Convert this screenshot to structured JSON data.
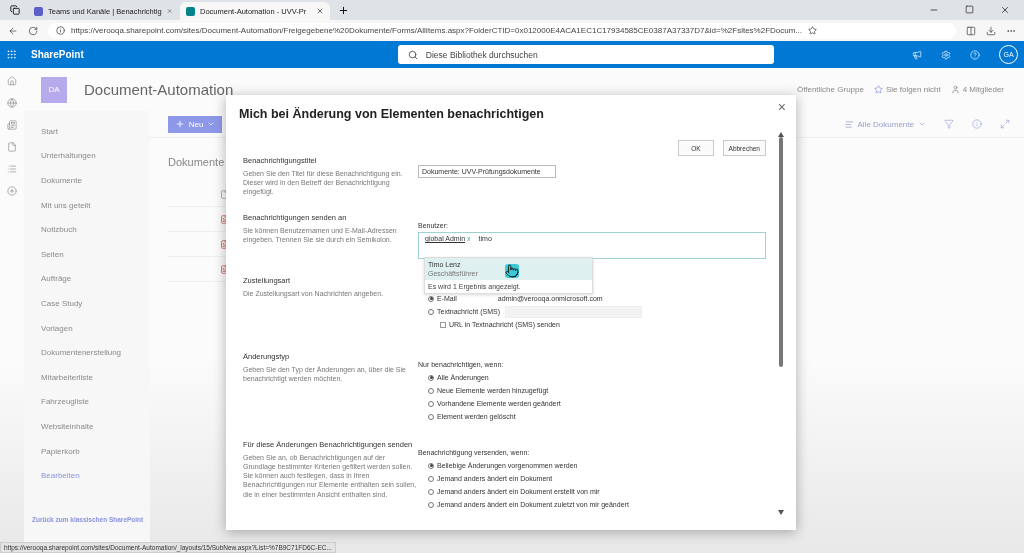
{
  "browser": {
    "tabs": [
      {
        "title": "Teams und Kanäle | Benachrichtig",
        "selected": false
      },
      {
        "title": "Document-Automation - UVV-Pr",
        "selected": true
      }
    ],
    "address": "https://verooqa.sharepoint.com/sites/Document-Automation/Freigegebene%20Dokumente/Forms/AllItems.aspx?FolderCTID=0x012000E4ACA1EC1C17934585CE0387A37337D7&id=%2Fsites%2FDocum..."
  },
  "suite": {
    "brand": "SharePoint",
    "search_placeholder": "Diese Bibliothek durchsuchen",
    "avatar": "GA"
  },
  "site": {
    "logo": "DA",
    "name": "Document-Automation",
    "privacy": "Öffentliche Gruppe",
    "follow": "Sie folgen nicht",
    "members": "4 Mitglieder"
  },
  "nav": {
    "items": [
      {
        "label": "Start",
        "kind": "item"
      },
      {
        "label": "Unterhaltungen",
        "kind": "item"
      },
      {
        "label": "Dokumente",
        "kind": "item"
      },
      {
        "label": "Mit uns geteilt",
        "kind": "item"
      },
      {
        "label": "Notizbuch",
        "kind": "item"
      },
      {
        "label": "Seiten",
        "kind": "item"
      },
      {
        "label": "Aufträge",
        "kind": "item"
      },
      {
        "label": "Case Study",
        "kind": "item"
      },
      {
        "label": "Vorlagen",
        "kind": "item"
      },
      {
        "label": "Dokumentenerstellung",
        "kind": "item"
      },
      {
        "label": "Mitarbeiterliste",
        "kind": "item"
      },
      {
        "label": "Fahrzeugliste",
        "kind": "item"
      },
      {
        "label": "Websiteinhalte",
        "kind": "item"
      },
      {
        "label": "Papierkorb",
        "kind": "item"
      },
      {
        "label": "Bearbeiten",
        "kind": "link"
      }
    ],
    "classic_link": "Zurück zum klassischen SharePoint"
  },
  "commands": {
    "new": "Neu",
    "view": "Alle Dokumente"
  },
  "library": {
    "title": "Dokumente",
    "files": [
      {
        "kind": "pdf"
      },
      {
        "kind": "pdf"
      },
      {
        "kind": "pdf"
      }
    ]
  },
  "dialog": {
    "title": "Mich bei Änderung von Elementen benachrichtigen",
    "close": "×",
    "buttons": [
      "OK",
      "Abbrechen"
    ],
    "sections": [
      {
        "kind": "text",
        "heading": "Benachrichtigungstitel",
        "description": "Geben Sie den Titel für diese Benachrichtigung ein. Dieser wird in den Betreff der Benachrichtigung eingefügt.",
        "value": "Dokumente: UVV-Prüfungsdokumente"
      },
      {
        "kind": "people",
        "heading": "Benachrichtigungen senden an",
        "description": "Sie können Benutzernamen und E-Mail-Adressen eingeben. Trennen Sie sie durch ein Semikolon.",
        "label": "Benutzer:",
        "tokens": [
          {
            "name": "global Admin",
            "remove": "x"
          }
        ],
        "typed": "timo",
        "suggestions": [
          {
            "name": "Timo Lenz",
            "subtitle": "Geschäftsführer",
            "selected": true
          }
        ],
        "result_note": "Es wird 1 Ergebnis angezeigt."
      },
      {
        "kind": "delivery",
        "heading": "Zustellungsart",
        "description": "Die Zustellungsart von Nachrichten angeben.",
        "options": [
          {
            "label": "E-Mail",
            "selected": true,
            "value": "admin@verooqa.onmicrosoft.com"
          },
          {
            "label": "Textnachricht (SMS)",
            "selected": false
          }
        ],
        "checkbox": {
          "label": "URL in Textnachricht (SMS) senden",
          "checked": false
        }
      },
      {
        "kind": "radios",
        "heading": "Änderungstyp",
        "description": "Geben Sie den Typ der Änderungen an, über die Sie benachrichtigt werden möchten.",
        "label": "Nur benachrichtigen, wenn:",
        "options": [
          {
            "label": "Alle Änderungen",
            "selected": true
          },
          {
            "label": "Neue Elemente werden hinzugefügt",
            "selected": false
          },
          {
            "label": "Vorhandene Elemente werden geändert",
            "selected": false
          },
          {
            "label": "Element werden gelöscht",
            "selected": false
          }
        ]
      },
      {
        "kind": "radios",
        "heading": "Für diese Änderungen Benachrichtigungen senden",
        "description": "Geben Sie an, ob Benachrichtigungen auf der Grundlage bestimmter Kriterien gefiltert werden sollen. Sie können auch festlegen, dass in Ihren Benachrichtigungen nur Elemente enthalten sein sollen, die in einer bestimmten Ansicht enthalten sind.",
        "label": "Benachrichtigung versenden, wenn:",
        "options": [
          {
            "label": "Beliebige Änderungen vorgenommen werden",
            "selected": true
          },
          {
            "label": "Jemand anders ändert ein Dokument",
            "selected": false
          },
          {
            "label": "Jemand anders ändert ein Dokument erstellt von mir",
            "selected": false
          },
          {
            "label": "Jemand anders ändert ein Dokument zuletzt von mir geändert",
            "selected": false
          }
        ]
      }
    ]
  },
  "status_url": "https://verooqa.sharepoint.com/sites/Document-Automation/_layouts/15/SubNew.aspx?List=%7B9C71FD6C-EC..."
}
